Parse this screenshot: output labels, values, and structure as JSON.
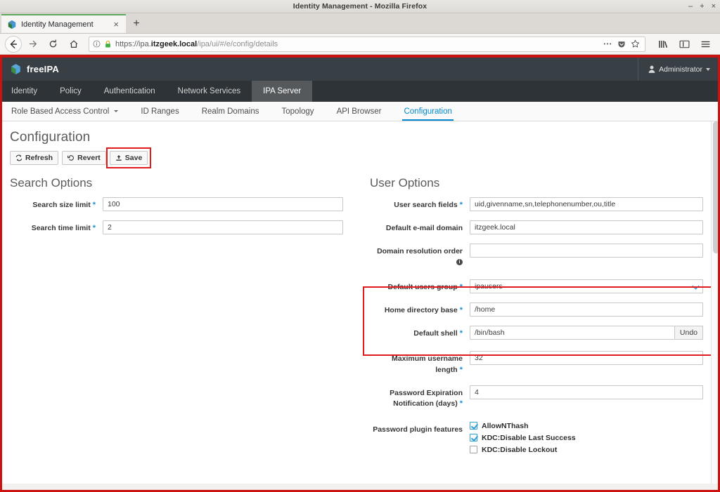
{
  "window": {
    "title": "Identity Management - Mozilla Firefox",
    "minimize": "–",
    "maximize": "+",
    "close": "×"
  },
  "browser": {
    "tab": {
      "title": "Identity Management",
      "close_label": "×",
      "favicon": "freeipa-favicon-icon"
    },
    "new_tab_label": "+",
    "nav": {
      "back": "←",
      "forward": "→",
      "reload": "↻",
      "home": "⌂"
    },
    "url": {
      "scheme": "https://ipa.",
      "domain": "itzgeek.local",
      "path": "/ipa/ui/#/e/config/details",
      "full": "https://ipa.itzgeek.local/ipa/ui/#/e/config/details"
    },
    "url_icons": [
      "page-info-icon",
      "lock-icon",
      "page-actions-icon",
      "pocket-icon",
      "bookmark-star-icon"
    ],
    "toolbar_icons": [
      "library-icon",
      "sidebar-icon",
      "hamburger-menu-icon"
    ]
  },
  "app": {
    "brand": "freeIPA",
    "user": "Administrator",
    "primary_nav": [
      {
        "label": "Identity",
        "active": false
      },
      {
        "label": "Policy",
        "active": false
      },
      {
        "label": "Authentication",
        "active": false
      },
      {
        "label": "Network Services",
        "active": false
      },
      {
        "label": "IPA Server",
        "active": true
      }
    ],
    "secondary_nav": [
      {
        "label": "Role Based Access Control",
        "active": false,
        "has_caret": true
      },
      {
        "label": "ID Ranges",
        "active": false,
        "has_caret": false
      },
      {
        "label": "Realm Domains",
        "active": false,
        "has_caret": false
      },
      {
        "label": "Topology",
        "active": false,
        "has_caret": false
      },
      {
        "label": "API Browser",
        "active": false,
        "has_caret": false
      },
      {
        "label": "Configuration",
        "active": true,
        "has_caret": false
      }
    ]
  },
  "page": {
    "title": "Configuration",
    "toolbar": {
      "refresh": "Refresh",
      "revert": "Revert",
      "save": "Save"
    }
  },
  "search_options": {
    "title": "Search Options",
    "fields": [
      {
        "label": "Search size limit",
        "required": true,
        "value": "100",
        "type": "text"
      },
      {
        "label": "Search time limit",
        "required": true,
        "value": "2",
        "type": "text"
      }
    ]
  },
  "user_options": {
    "title": "User Options",
    "fields": [
      {
        "label": "User search fields",
        "required": true,
        "value": "uid,givenname,sn,telephonenumber,ou,title",
        "type": "text"
      },
      {
        "label": "Default e-mail domain",
        "required": false,
        "value": "itzgeek.local",
        "type": "text"
      },
      {
        "label": "Domain resolution order",
        "required": false,
        "value": "",
        "type": "text",
        "info": true
      },
      {
        "label": "Default users group",
        "required": true,
        "value": "ipausers",
        "type": "select"
      },
      {
        "label": "Home directory base",
        "required": true,
        "value": "/home",
        "type": "text"
      },
      {
        "label": "Default shell",
        "required": true,
        "value": "/bin/bash",
        "type": "text-undo",
        "undo_label": "Undo"
      },
      {
        "label": "Maximum username length",
        "required": true,
        "value": "32",
        "type": "text"
      },
      {
        "label": "Password Expiration Notification (days)",
        "required": true,
        "value": "4",
        "type": "text"
      }
    ],
    "password_plugin": {
      "label": "Password plugin features",
      "options": [
        {
          "label": "AllowNThash",
          "checked": true
        },
        {
          "label": "KDC:Disable Last Success",
          "checked": true
        },
        {
          "label": "KDC:Disable Lockout",
          "checked": false
        }
      ]
    }
  },
  "highlights": {
    "accent_red": "#cc1111",
    "brand_blue": "#0088ce"
  }
}
